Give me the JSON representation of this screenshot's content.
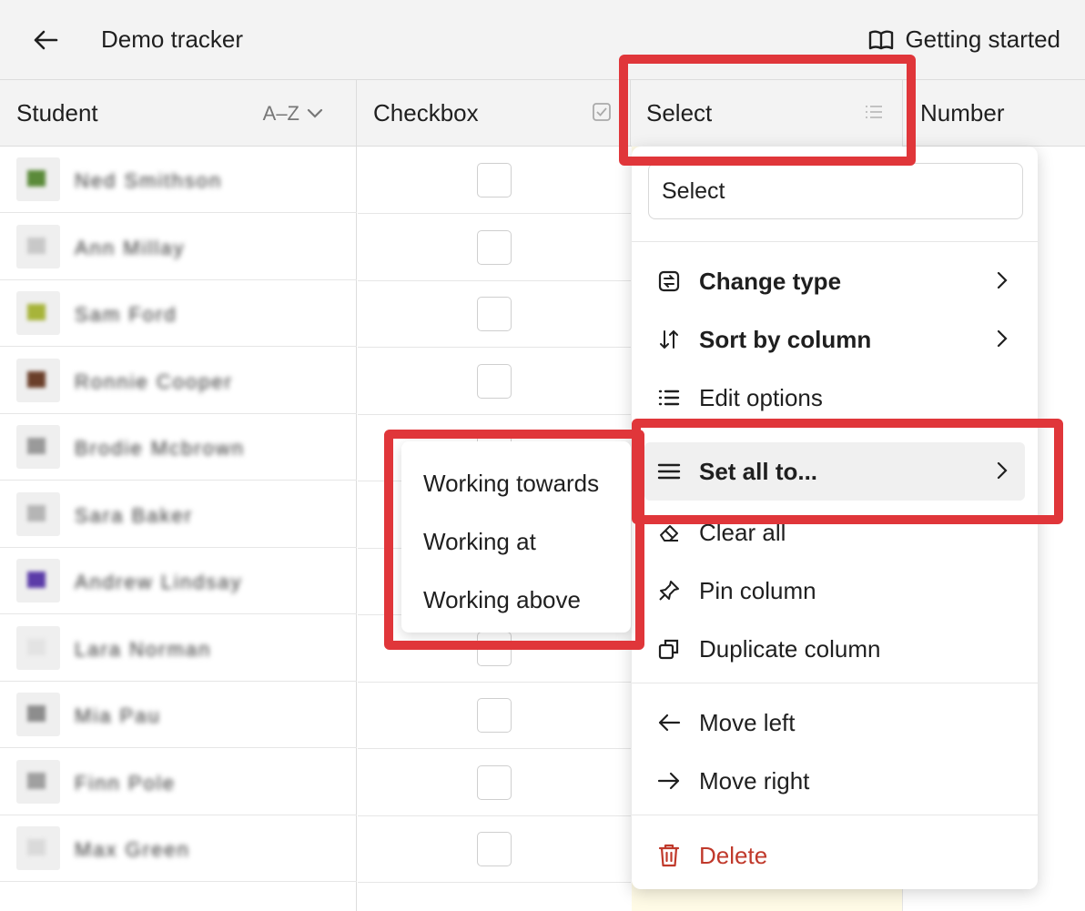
{
  "topbar": {
    "title": "Demo tracker",
    "help_label": "Getting started"
  },
  "columns": {
    "student": {
      "label": "Student",
      "sort_label": "A–Z"
    },
    "checkbox": {
      "label": "Checkbox"
    },
    "select": {
      "label": "Select"
    },
    "number": {
      "label": "Number"
    }
  },
  "students": [
    {
      "name": "Ned Smithson",
      "avatar_color": "#5b8a3a"
    },
    {
      "name": "Ann Millay",
      "avatar_color": "#c8c8c8"
    },
    {
      "name": "Sam Ford",
      "avatar_color": "#a7b43a"
    },
    {
      "name": "Ronnie Cooper",
      "avatar_color": "#6b3f2a"
    },
    {
      "name": "Brodie Mcbrown",
      "avatar_color": "#9a9a9a"
    },
    {
      "name": "Sara Baker",
      "avatar_color": "#b5b5b5"
    },
    {
      "name": "Andrew Lindsay",
      "avatar_color": "#5b3ca8"
    },
    {
      "name": "Lara Norman",
      "avatar_color": "#e3e3e3"
    },
    {
      "name": "Mia Pau",
      "avatar_color": "#8d8d8d"
    },
    {
      "name": "Finn Pole",
      "avatar_color": "#a0a0a0"
    },
    {
      "name": "Max Green",
      "avatar_color": "#dadada"
    }
  ],
  "menu": {
    "input_value": "Select",
    "items": [
      {
        "label": "Change type",
        "icon": "change-type-icon"
      },
      {
        "label": "Sort by column",
        "icon": "sort-icon"
      },
      {
        "label": "Edit options",
        "icon": "list-icon"
      },
      {
        "label": "Set all to...",
        "icon": "menu-lines-icon"
      },
      {
        "label": "Clear all",
        "icon": "eraser-icon"
      },
      {
        "label": "Pin column",
        "icon": "pin-icon"
      },
      {
        "label": "Duplicate column",
        "icon": "duplicate-icon"
      },
      {
        "label": "Move left",
        "icon": "arrow-left-icon"
      },
      {
        "label": "Move right",
        "icon": "arrow-right-icon"
      },
      {
        "label": "Delete",
        "icon": "trash-icon"
      }
    ]
  },
  "submenu": {
    "items": [
      "Working towards",
      "Working at",
      "Working above"
    ]
  },
  "colors": {
    "highlight": "#e0363a",
    "danger": "#c0392b",
    "select_column_bg": "#fffbe6"
  }
}
